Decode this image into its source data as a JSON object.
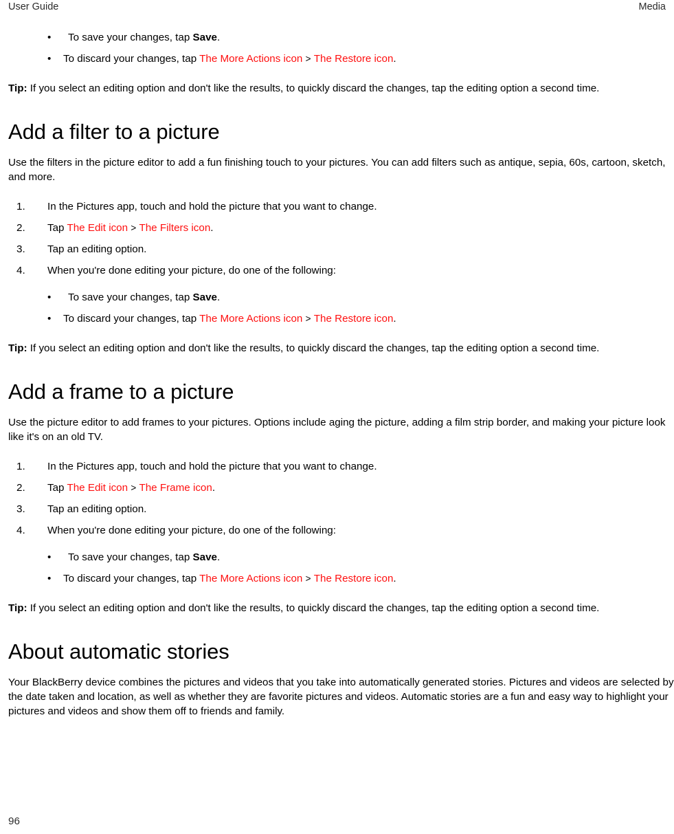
{
  "header": {
    "left": "User Guide",
    "right": "Media"
  },
  "footer": {
    "page_number": "96"
  },
  "colors": {
    "icon_reference_red": "#ff1010",
    "text_black": "#000000"
  },
  "labels": {
    "separator": ">",
    "period": ".",
    "bullet_glyph": "•"
  },
  "top_bullets": {
    "save": {
      "pre": "To save your changes, tap ",
      "strong": "Save",
      "post": "."
    },
    "discard": {
      "pre": "To discard your changes, tap ",
      "icon1": "The More Actions icon",
      "sep": ">",
      "icon2": "The Restore icon",
      "post": "."
    }
  },
  "tip_block": {
    "label": "Tip:",
    "text": " If you select an editing option and don't like the results, to quickly discard the changes, tap the editing option a second time."
  },
  "sections": [
    {
      "id": "add-a-filter",
      "title": "Add a filter to a picture",
      "intro": "Use the filters in the picture editor to add a fun finishing touch to your pictures. You can add filters such as antique, sepia, 60s, cartoon, sketch, and more.",
      "steps": [
        {
          "number": "1.",
          "text": "In the Pictures app, touch and hold the picture that you want to change."
        },
        {
          "number": "2.",
          "pre": "Tap ",
          "icon1": "The Edit icon",
          "sep": ">",
          "icon2": "The Filters icon",
          "post": "."
        },
        {
          "number": "3.",
          "text": "Tap an editing option."
        },
        {
          "number": "4.",
          "text": "When you're done editing your picture, do one of the following:"
        }
      ],
      "bullets": {
        "save": {
          "pre": "To save your changes, tap ",
          "strong": "Save",
          "post": "."
        },
        "discard": {
          "pre": "To discard your changes, tap ",
          "icon1": "The More Actions icon",
          "sep": ">",
          "icon2": "The Restore icon",
          "post": "."
        }
      },
      "tip": {
        "label": "Tip:",
        "text": " If you select an editing option and don't like the results, to quickly discard the changes, tap the editing option a second time."
      }
    },
    {
      "id": "add-a-frame",
      "title": "Add a frame to a picture",
      "intro": "Use the picture editor to add frames to your pictures. Options include aging the picture, adding a film strip border, and making your picture look like it's on an old TV.",
      "steps": [
        {
          "number": "1.",
          "text": "In the Pictures app, touch and hold the picture that you want to change."
        },
        {
          "number": "2.",
          "pre": "Tap ",
          "icon1": "The Edit icon",
          "sep": ">",
          "icon2": "The Frame icon",
          "post": "."
        },
        {
          "number": "3.",
          "text": "Tap an editing option."
        },
        {
          "number": "4.",
          "text": "When you're done editing your picture, do one of the following:"
        }
      ],
      "bullets": {
        "save": {
          "pre": "To save your changes, tap ",
          "strong": "Save",
          "post": "."
        },
        "discard": {
          "pre": "To discard your changes, tap ",
          "icon1": "The More Actions icon",
          "sep": ">",
          "icon2": "The Restore icon",
          "post": "."
        }
      },
      "tip": {
        "label": "Tip:",
        "text": " If you select an editing option and don't like the results, to quickly discard the changes, tap the editing option a second time."
      }
    },
    {
      "id": "about-automatic-stories",
      "title": "About automatic stories",
      "intro": "Your BlackBerry device combines the pictures and videos that you take into automatically generated stories. Pictures and videos are selected by the date taken and location, as well as whether they are favorite pictures and videos. Automatic stories are a fun and easy way to highlight your pictures and videos and show them off to friends and family."
    }
  ]
}
